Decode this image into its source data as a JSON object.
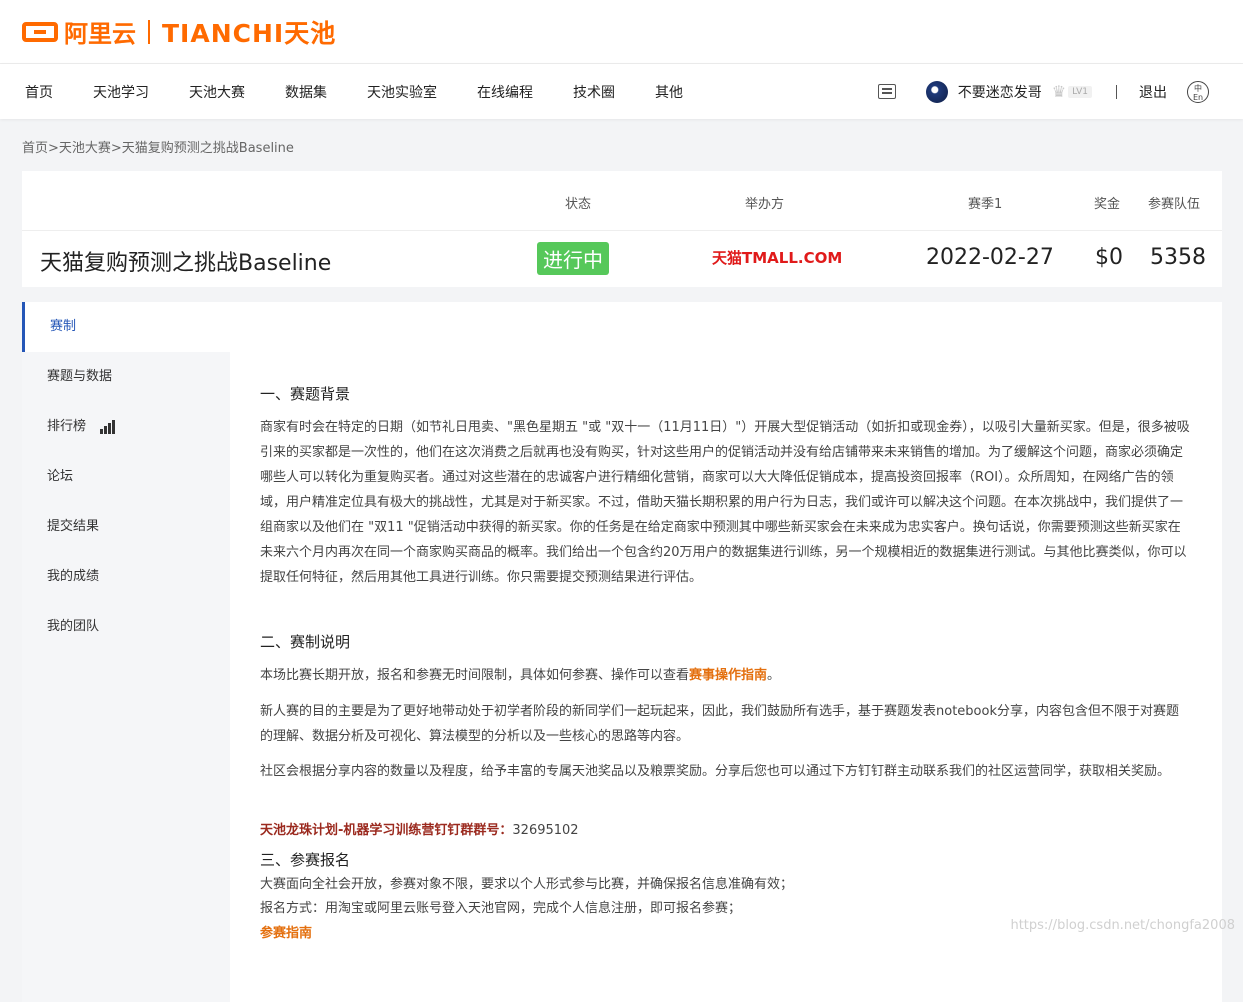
{
  "brand": {
    "logo_text": "阿里云",
    "tianchi": "TIANCHI天池"
  },
  "nav": {
    "items": [
      "首页",
      "天池学习",
      "天池大赛",
      "数据集",
      "天池实验室",
      "在线编程",
      "技术圈",
      "其他"
    ],
    "username": "不要迷恋发哥",
    "level": "LV1",
    "separator": "|",
    "logout": "退出",
    "lang": "中En"
  },
  "breadcrumb": "首页>天池大赛>天猫复购预测之挑战Baseline",
  "competition": {
    "headers": {
      "status": "状态",
      "organizer": "举办方",
      "season": "赛季1",
      "prize": "奖金",
      "teams": "参赛队伍"
    },
    "title": "天猫复购预测之挑战Baseline",
    "status": "进行中",
    "organizer_logo": "天猫TMALL.COM",
    "date": "2022-02-27",
    "prize": "$0",
    "teams": "5358"
  },
  "sidebar": {
    "items": [
      {
        "label": "赛制"
      },
      {
        "label": "赛题与数据"
      },
      {
        "label": "排行榜"
      },
      {
        "label": "论坛"
      },
      {
        "label": "提交结果"
      },
      {
        "label": "我的成绩"
      },
      {
        "label": "我的团队"
      }
    ]
  },
  "content": {
    "s1_title": "一、赛题背景",
    "s1_body": "商家有时会在特定的日期（如节礼日甩卖、\"黑色星期五 \"或 \"双十一（11月11日）\"）开展大型促销活动（如折扣或现金券），以吸引大量新买家。但是，很多被吸引来的买家都是一次性的，他们在这次消费之后就再也没有购买，针对这些用户的促销活动并没有给店铺带来未来销售的增加。为了缓解这个问题，商家必须确定哪些人可以转化为重复购买者。通过对这些潜在的忠诚客户进行精细化营销，商家可以大大降低促销成本，提高投资回报率（ROI）。众所周知，在网络广告的领域，用户精准定位具有极大的挑战性，尤其是对于新买家。不过，借助天猫长期积累的用户行为日志，我们或许可以解决这个问题。在本次挑战中，我们提供了一组商家以及他们在 \"双11 \"促销活动中获得的新买家。你的任务是在给定商家中预测其中哪些新买家会在未来成为忠实客户。换句话说，你需要预测这些新买家在未来六个月内再次在同一个商家购买商品的概率。我们给出一个包含约20万用户的数据集进行训练，另一个规模相近的数据集进行测试。与其他比赛类似，你可以提取任何特征，然后用其他工具进行训练。你只需要提交预测结果进行评估。",
    "s2_title": "二、赛制说明",
    "s2_p1_pre": "本场比赛长期开放，报名和参赛无时间限制，具体如何参赛、操作可以查看",
    "s2_p1_link": "赛事操作指南",
    "s2_p1_post": "。",
    "s2_p2": "新人赛的目的主要是为了更好地带动处于初学者阶段的新同学们一起玩起来，因此，我们鼓励所有选手，基于赛题发表notebook分享，内容包含但不限于对赛题的理解、数据分析及可视化、算法模型的分析以及一些核心的思路等内容。",
    "s2_p3": "社区会根据分享内容的数量以及程度，给予丰富的专属天池奖品以及粮票奖励。分享后您也可以通过下方钉钉群主动联系我们的社区运营同学，获取相关奖励。",
    "s2_group_label": "天池龙珠计划-机器学习训练营钉钉群群号：",
    "s2_group_num": "32695102",
    "s3_title": "三、参赛报名",
    "s3_p1": "大赛面向全社会开放，参赛对象不限，要求以个人形式参与比赛，并确保报名信息准确有效；",
    "s3_p2": "报名方式：用淘宝或阿里云账号登入天池官网，完成个人信息注册，即可报名参赛；",
    "s3_link": "参赛指南"
  },
  "watermark": "https://blog.csdn.net/chongfa2008",
  "colors": {
    "brand_orange": "#ff6a00",
    "active_blue": "#2456b7",
    "status_green": "#56c85a",
    "tmall_red": "#e01a1a"
  }
}
